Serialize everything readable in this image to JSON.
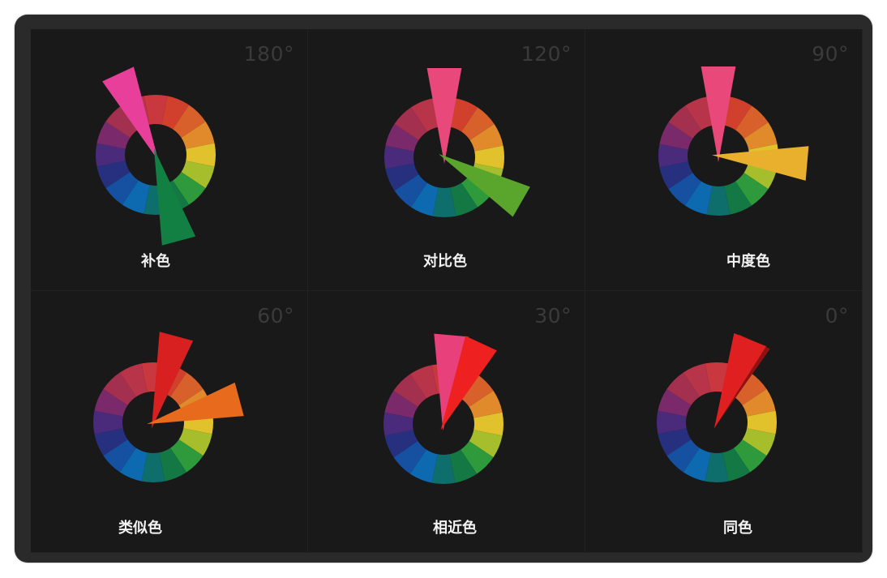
{
  "panels": [
    {
      "degree": "180°",
      "name": "补色",
      "pointers": [
        {
          "angle": -25,
          "color": "#e8409a"
        },
        {
          "angle": 165,
          "color": "#138043"
        }
      ]
    },
    {
      "degree": "120°",
      "name": "对比色",
      "pointers": [
        {
          "angle": 0,
          "color": "#e8487a"
        },
        {
          "angle": 120,
          "color": "#5aa52c"
        }
      ]
    },
    {
      "degree": "90°",
      "name": "中度色",
      "pointers": [
        {
          "angle": 0,
          "color": "#e8487a"
        },
        {
          "angle": 95,
          "color": "#e8b02c"
        }
      ]
    },
    {
      "degree": "60°",
      "name": "类似色",
      "pointers": [
        {
          "angle": 15,
          "color": "#d82020"
        },
        {
          "angle": 75,
          "color": "#e86a1c"
        }
      ]
    },
    {
      "degree": "30°",
      "name": "相近色",
      "pointers": [
        {
          "angle": 5,
          "color": "#e8407a"
        },
        {
          "angle": 25,
          "color": "#ee2020"
        }
      ]
    },
    {
      "degree": "0°",
      "name": "同色",
      "pointers": [
        {
          "angle": 25,
          "color": "#8e1212"
        },
        {
          "angle": 22,
          "color": "#e02020"
        }
      ]
    }
  ],
  "wheel_colors": [
    "#c8383e",
    "#d0402c",
    "#d8602a",
    "#e08a2c",
    "#e2c22c",
    "#a6be2c",
    "#2e9a3c",
    "#147844",
    "#0e6e6c",
    "#0e6ab0",
    "#1650a0",
    "#26307e",
    "#4a2a7a",
    "#7a2a6a",
    "#a43050",
    "#b83448"
  ]
}
